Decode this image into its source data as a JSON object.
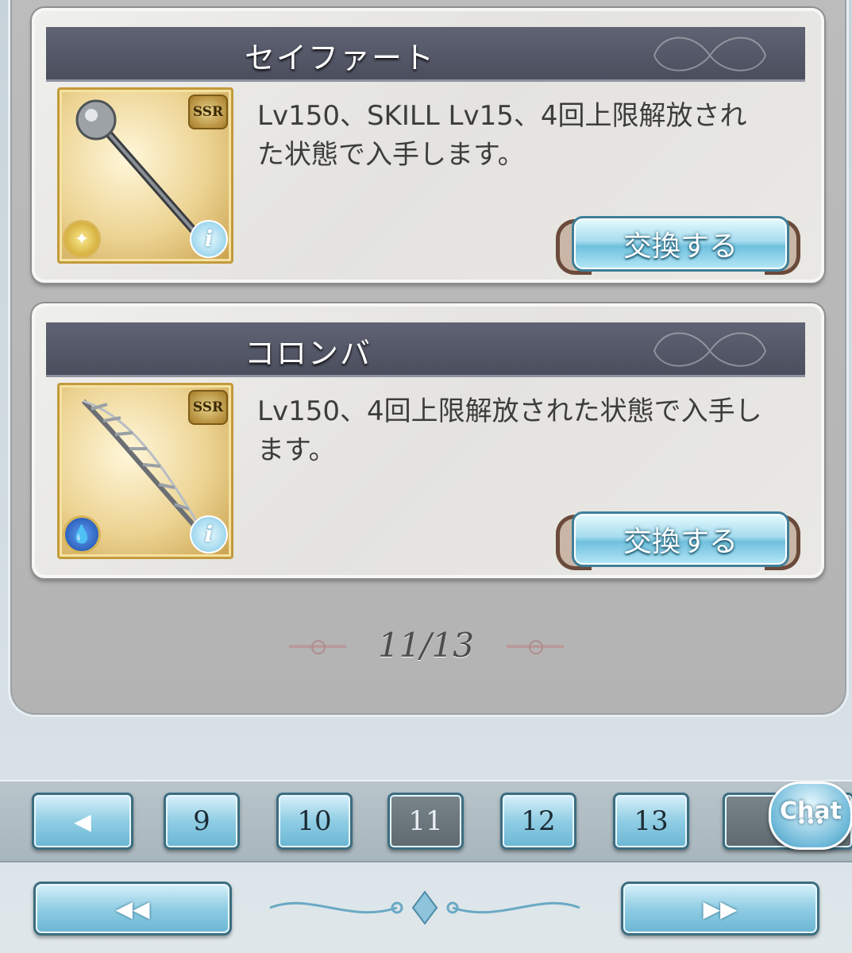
{
  "items": [
    {
      "name": "セイファート",
      "rarity": "SSR",
      "element_icon": "light-element-icon",
      "description": "Lv150、SKILL Lv15、4回上限解放された状態で入手します。",
      "exchange_label": "交換する"
    },
    {
      "name": "コロンバ",
      "rarity": "SSR",
      "element_icon": "water-element-icon",
      "description": "Lv150、4回上限解放された状態で入手します。",
      "exchange_label": "交換する"
    }
  ],
  "page_indicator": "11/13",
  "pagination": {
    "pages": [
      "9",
      "10",
      "11",
      "12",
      "13"
    ],
    "current": "11",
    "prev_icon": "◀",
    "first_icon": "◀◀",
    "last_icon": "▶▶"
  },
  "chat_label": "Chat",
  "chat_dots": "•••",
  "info_glyph": "i",
  "colors": {
    "button_blue": "#8fcde4",
    "title_bar": "#4a4e5d",
    "panel_gray": "#b3b3b3"
  }
}
